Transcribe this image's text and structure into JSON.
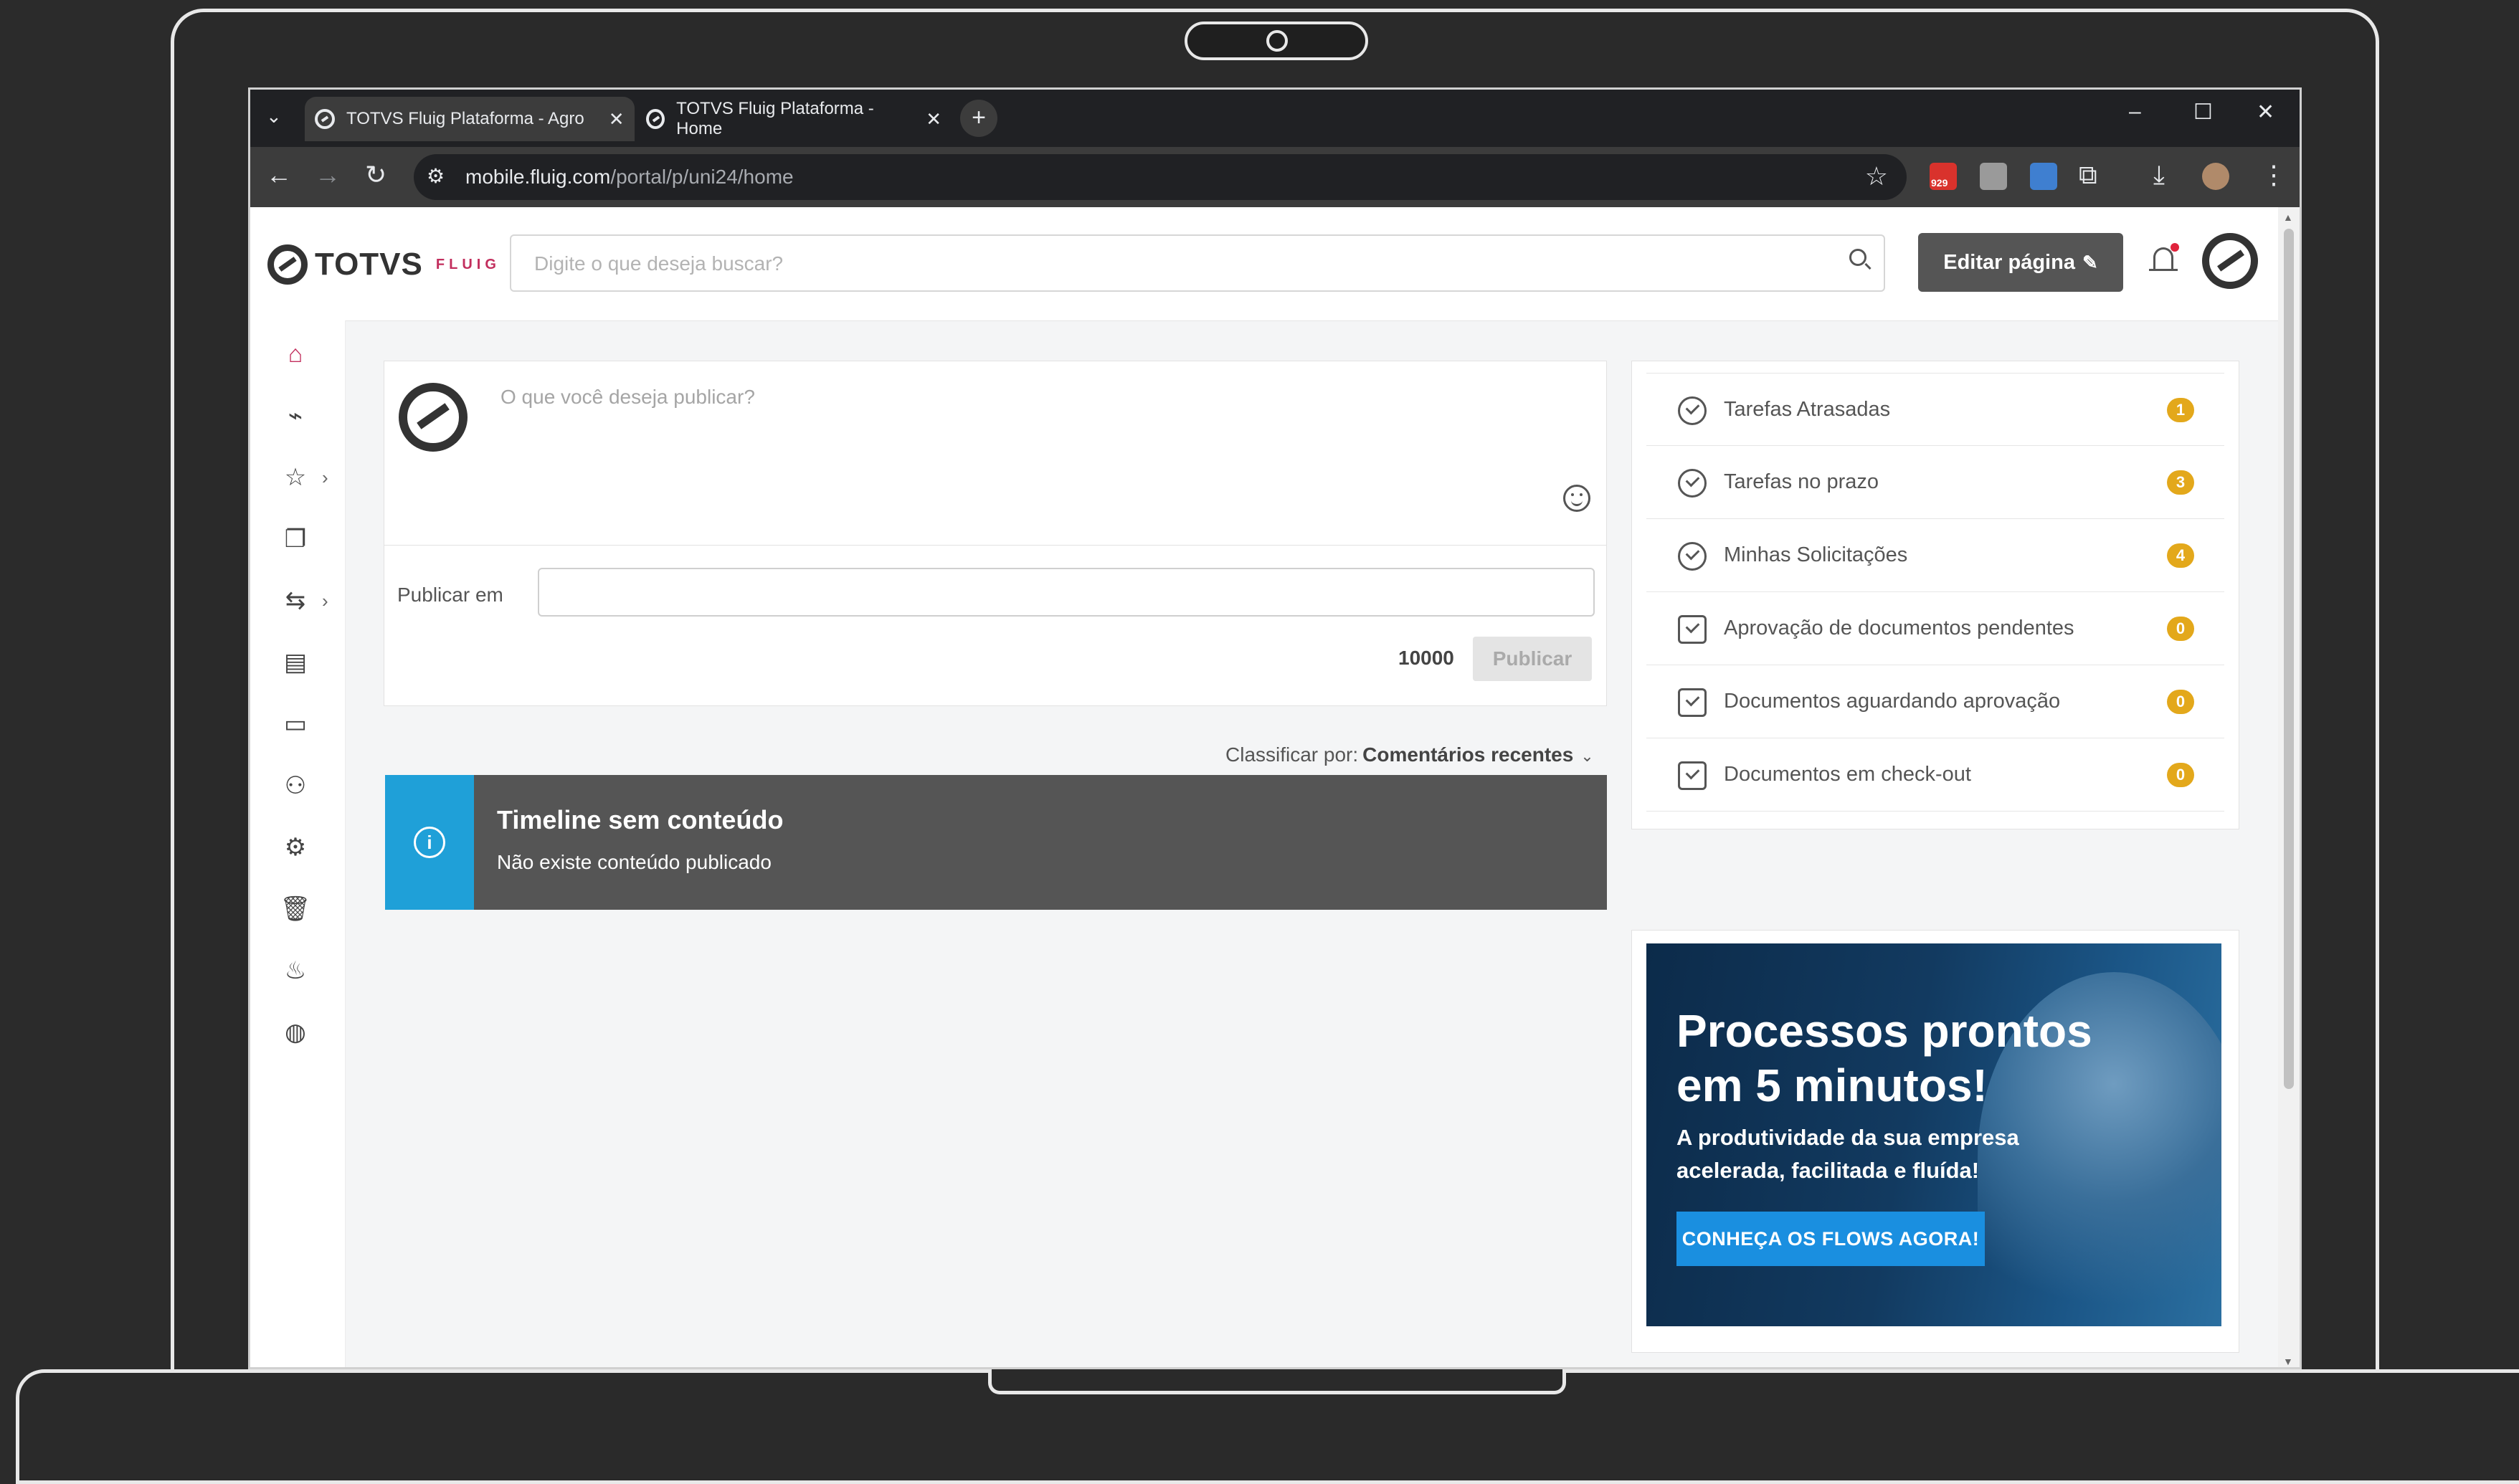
{
  "browser": {
    "tabs": [
      {
        "title": "TOTVS Fluig Plataforma - Agro",
        "active": true
      },
      {
        "title": "TOTVS Fluig Plataforma - Home",
        "active": false
      }
    ],
    "url_host": "mobile.fluig.com",
    "url_path": "/portal/p/uni24/home",
    "extension_badge": "929"
  },
  "header": {
    "logo_text": "TOTVS",
    "logo_sub": "FLUIG",
    "search_placeholder": "Digite o que deseja buscar?",
    "edit_button": "Editar página"
  },
  "sidebar": {
    "items": [
      {
        "icon": "home-icon",
        "active": true
      },
      {
        "icon": "pulse-icon"
      },
      {
        "icon": "star-icon",
        "has_submenu": true
      },
      {
        "icon": "documents-icon"
      },
      {
        "icon": "workflow-icon",
        "has_submenu": true
      },
      {
        "icon": "presentation-icon"
      },
      {
        "icon": "chat-icon"
      },
      {
        "icon": "users-icon"
      },
      {
        "icon": "settings-icon"
      },
      {
        "icon": "trash-icon"
      },
      {
        "icon": "fire-icon"
      },
      {
        "icon": "globe-icon"
      }
    ]
  },
  "publish": {
    "prompt": "O que você deseja publicar?",
    "publish_in_label": "Publicar em",
    "char_count": "10000",
    "publish_button": "Publicar"
  },
  "sort": {
    "label": "Classificar por:",
    "value": "Comentários recentes"
  },
  "timeline": {
    "title": "Timeline sem conteúdo",
    "description": "Não existe conteúdo publicado"
  },
  "tasks": [
    {
      "label": "Tarefas Atrasadas",
      "count": "1",
      "icon": "clock-check-icon"
    },
    {
      "label": "Tarefas no prazo",
      "count": "3",
      "icon": "clock-check-icon"
    },
    {
      "label": "Minhas Solicitações",
      "count": "4",
      "icon": "user-clock-icon"
    },
    {
      "label": "Aprovação de documentos pendentes",
      "count": "0",
      "icon": "document-clock-icon"
    },
    {
      "label": "Documentos aguardando aprovação",
      "count": "0",
      "icon": "document-lock-icon"
    },
    {
      "label": "Documentos em check-out",
      "count": "0",
      "icon": "document-checkout-icon"
    }
  ],
  "banner": {
    "headline": "Processos prontos em 5 minutos!",
    "subtext": "A produtividade da sua empresa acelerada, facilitada e fluída!",
    "cta": "CONHEÇA OS FLOWS AGORA!"
  },
  "colors": {
    "brand": "#c22e5d",
    "info": "#1fa0d8",
    "badge": "#e3a81b",
    "cta": "#1a8fe0"
  }
}
